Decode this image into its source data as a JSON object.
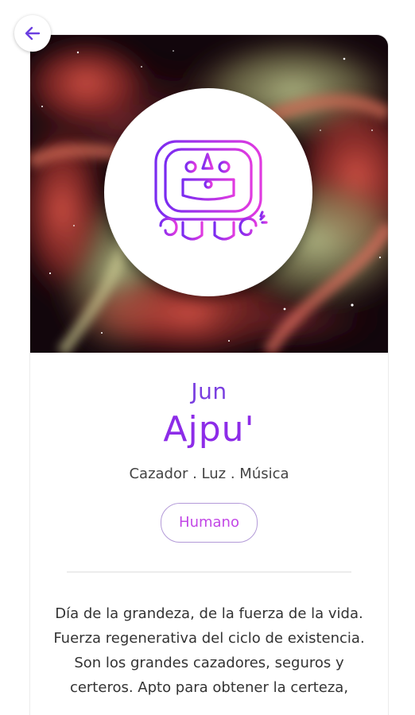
{
  "back": {
    "icon": "arrow-left-icon"
  },
  "hero": {
    "glyph": "ajpu-glyph-icon"
  },
  "nawal": {
    "number": "Jun",
    "name": "Ajpu'",
    "keywords": "Cazador . Luz . Música",
    "tag": "Humano",
    "description": "Día de la grandeza, de la fuerza de la vida. Fuerza regenerativa del ciclo de existencia. Son los grandes cazadores, seguros y certeros. Apto para obtener la certeza,"
  },
  "colors": {
    "accent": "#8d2ce8",
    "accent_secondary": "#c247e6",
    "back_arrow": "#6b3fe0"
  }
}
